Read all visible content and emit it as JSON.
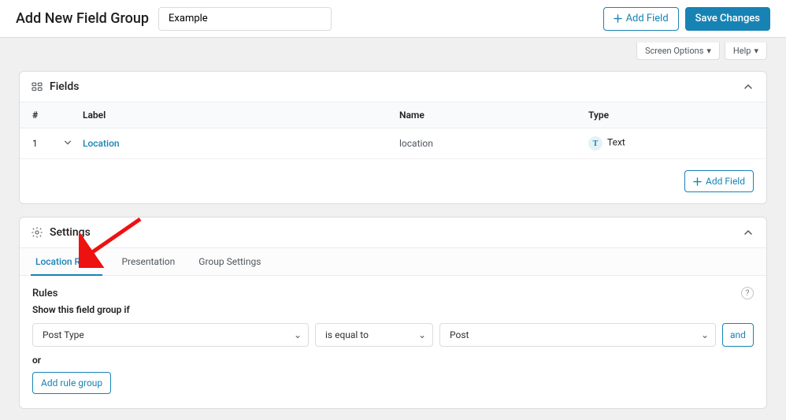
{
  "header": {
    "page_title": "Add New Field Group",
    "title_value": "Example",
    "add_field": "Add Field",
    "save_changes": "Save Changes"
  },
  "meta": {
    "screen_options": "Screen Options",
    "help": "Help"
  },
  "fields_panel": {
    "title": "Fields",
    "columns": {
      "num": "#",
      "label": "Label",
      "name": "Name",
      "type": "Type"
    },
    "rows": [
      {
        "num": "1",
        "label": "Location",
        "name": "location",
        "type_short": "T",
        "type": "Text"
      }
    ],
    "add_field": "Add Field"
  },
  "settings_panel": {
    "title": "Settings",
    "tabs": {
      "location_rules": "Location Rules",
      "presentation": "Presentation",
      "group_settings": "Group Settings"
    },
    "rules": {
      "heading": "Rules",
      "sub": "Show this field group if",
      "param": "Post Type",
      "operator": "is equal to",
      "value": "Post",
      "and": "and",
      "or": "or",
      "add_group": "Add rule group"
    }
  },
  "colors": {
    "accent": "#1783b5"
  }
}
